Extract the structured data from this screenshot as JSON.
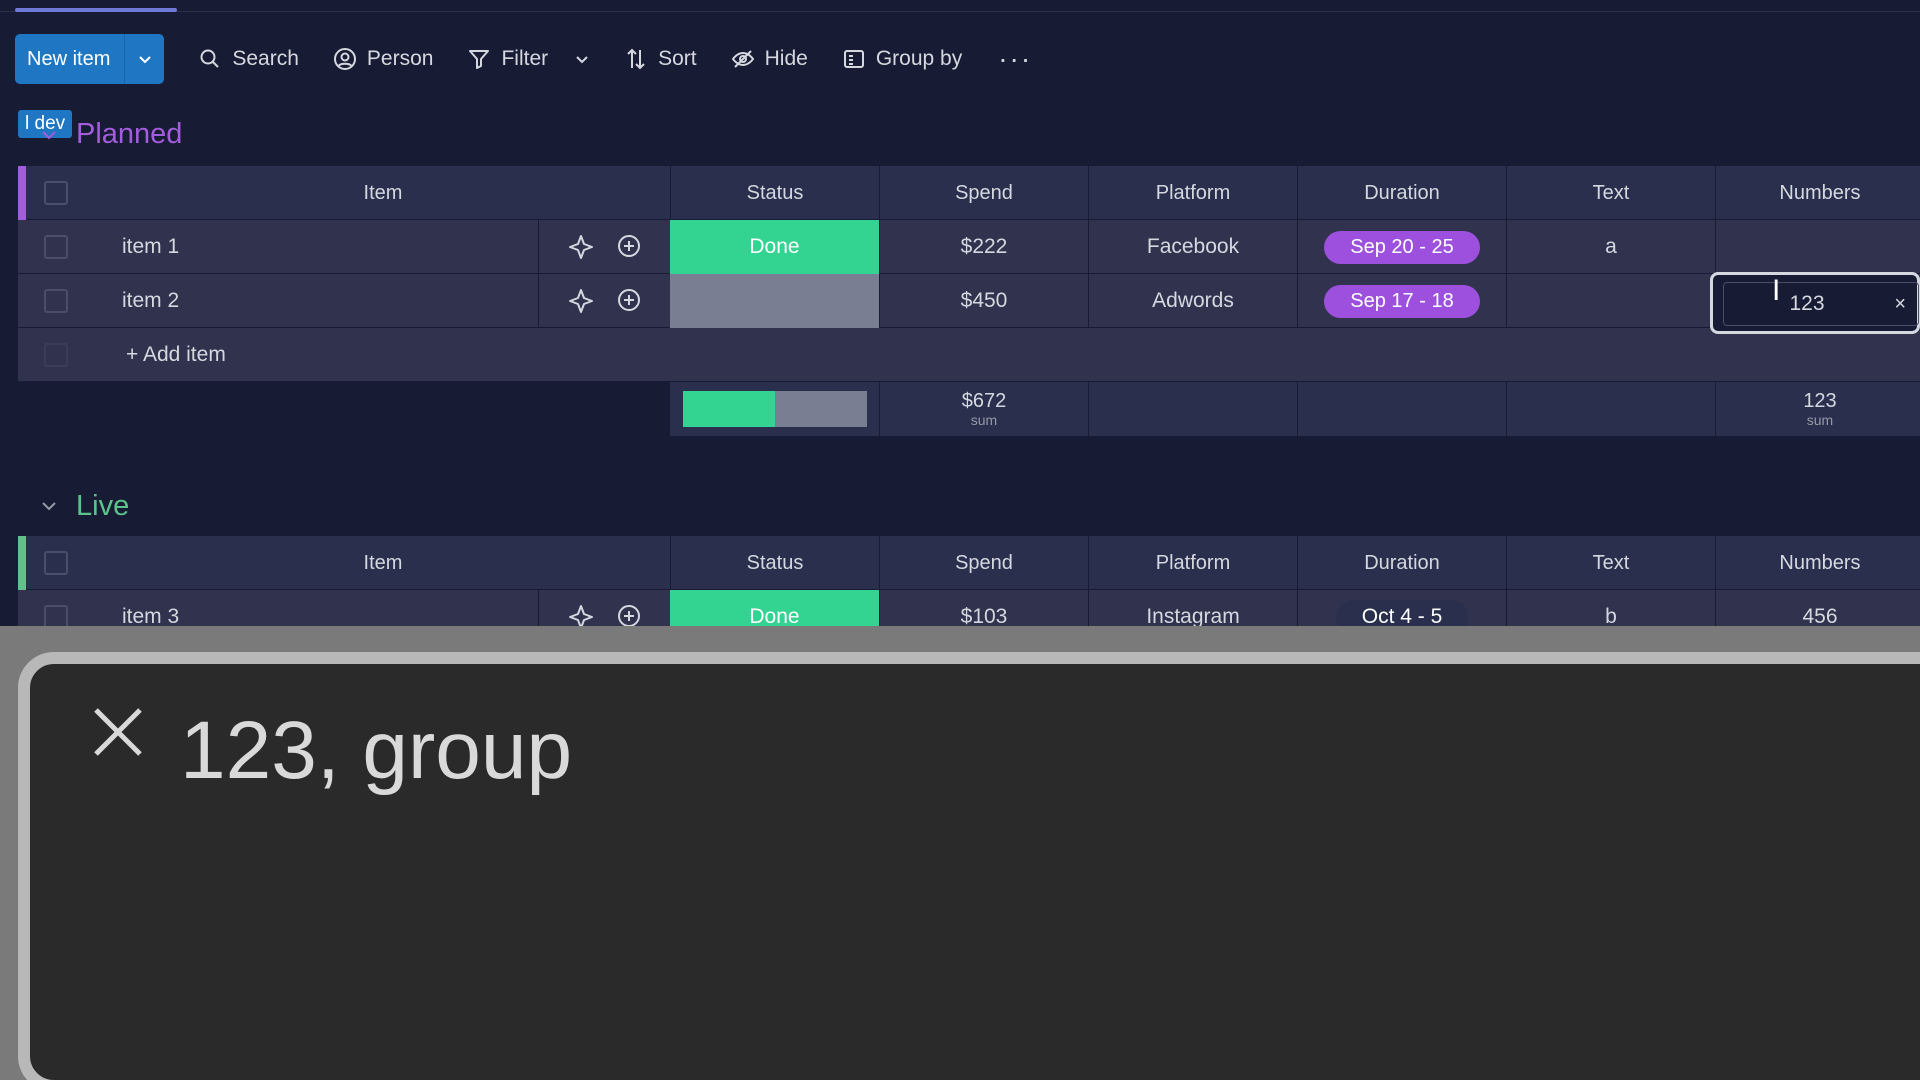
{
  "toolbar": {
    "new_item": "New item",
    "search": "Search",
    "person": "Person",
    "filter": "Filter",
    "sort": "Sort",
    "hide": "Hide",
    "group_by": "Group by",
    "more": "···"
  },
  "dev_tag": "l dev",
  "columns": {
    "item": "Item",
    "status": "Status",
    "spend": "Spend",
    "platform": "Platform",
    "duration": "Duration",
    "text": "Text",
    "numbers": "Numbers"
  },
  "groups": {
    "planned": {
      "title": "Planned",
      "color": "#a25ddc",
      "rows": [
        {
          "name": "item 1",
          "status": "Done",
          "spend": "$222",
          "platform": "Facebook",
          "duration": "Sep 20 - 25",
          "text": "a",
          "numbers": ""
        },
        {
          "name": "item 2",
          "status": "",
          "spend": "$450",
          "platform": "Adwords",
          "duration": "Sep 17 - 18",
          "text": "",
          "numbers": "123"
        }
      ],
      "add_item": "+ Add item",
      "summary": {
        "spend": "$672",
        "spend_label": "sum",
        "numbers": "123",
        "numbers_label": "sum",
        "status_done_fraction": 0.5
      }
    },
    "live": {
      "title": "Live",
      "color": "#5cc48a",
      "rows": [
        {
          "name": "item 3",
          "status": "Done",
          "spend": "$103",
          "platform": "Instagram",
          "duration": "Oct 4 - 5",
          "text": "b",
          "numbers": "456"
        }
      ]
    }
  },
  "editor": {
    "value": "123",
    "clear": "×"
  },
  "caption": {
    "text": "123, group"
  },
  "colors": {
    "done": "#33d391",
    "empty_status": "#797e93",
    "duration_pill": "#9d50dd",
    "primary": "#1f76c2"
  }
}
